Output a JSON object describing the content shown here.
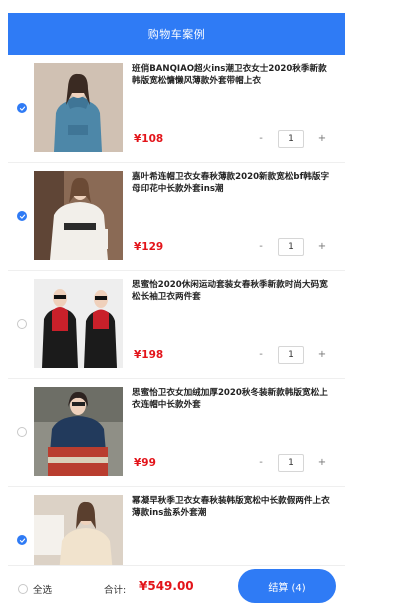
{
  "header": {
    "title": "购物车案例"
  },
  "items": [
    {
      "checked": true,
      "title": "班俏BANQIAO超火ins潮卫衣女士2020秋季新款韩版宽松慵懒风薄款外套带帽上衣",
      "price": "¥108",
      "qty": "1",
      "minus": "-",
      "plus": "+",
      "image": "woman-blue-hoodie"
    },
    {
      "checked": true,
      "title": "嘉叶希连帽卫衣女春秋薄款2020新款宽松bf韩版字母印花中长款外套ins潮",
      "price": "¥129",
      "qty": "1",
      "minus": "-",
      "plus": "+",
      "image": "woman-white-hoodie"
    },
    {
      "checked": false,
      "title": "思蜜怡2020休闲运动套装女春秋季新款时尚大码宽松长袖卫衣两件套",
      "price": "¥198",
      "qty": "1",
      "minus": "-",
      "plus": "+",
      "image": "black-red-tracksuit"
    },
    {
      "checked": false,
      "title": "思蜜怡卫衣女加绒加厚2020秋冬装新款韩版宽松上衣连帽中长款外套",
      "price": "¥99",
      "qty": "1",
      "minus": "-",
      "plus": "+",
      "image": "colorblock-hoodie"
    },
    {
      "checked": true,
      "title": "幂凝早秋季卫衣女春秋装韩版宽松中长款假两件上衣薄款ins盐系外套潮",
      "price": "",
      "qty": "",
      "minus": "",
      "plus": "",
      "image": "cream-sweatshirt"
    }
  ],
  "footer": {
    "select_all": "全选",
    "select_all_checked": false,
    "total_label": "合计:",
    "total_value": "¥549.00",
    "checkout_label": "结算 (4)"
  },
  "colors": {
    "primary": "#2f7bf5",
    "price": "#e3141a"
  }
}
